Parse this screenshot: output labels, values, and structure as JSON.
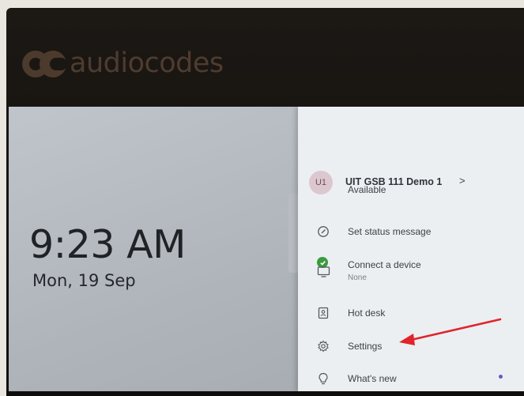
{
  "brand": {
    "logo_text": "audiocodes"
  },
  "clock": {
    "time": "9:23 AM",
    "date": "Mon, 19 Sep"
  },
  "menu": {
    "user": {
      "initials": "U1",
      "name": "UIT GSB 111 Demo 1",
      "chevron": ">"
    },
    "items": [
      {
        "label": "Available",
        "icon": "status-available-icon"
      },
      {
        "label": "Set status message",
        "icon": "edit-status-icon"
      },
      {
        "label": "Connect a device",
        "sublabel": "None",
        "icon": "monitor-icon"
      },
      {
        "label": "Hot desk",
        "icon": "hot-desk-badge-icon"
      },
      {
        "label": "Settings",
        "icon": "gear-icon"
      },
      {
        "label": "What's new",
        "icon": "lightbulb-icon"
      }
    ]
  },
  "colors": {
    "available": "#3a9b3f",
    "annotation_arrow": "#e0242a",
    "new_dot": "#5b5fc7"
  }
}
